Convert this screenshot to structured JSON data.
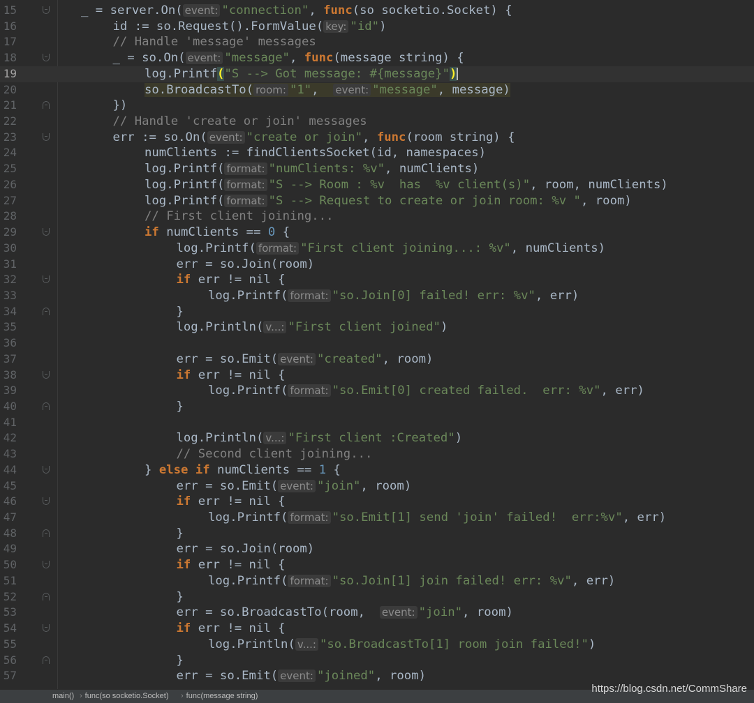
{
  "editor": {
    "current_line": 19,
    "lines": [
      {
        "n": 15,
        "fold": "open",
        "indent": 1,
        "tokens": [
          [
            "t",
            "_ = server.On("
          ],
          [
            "h",
            "event:"
          ],
          [
            "s",
            "\"connection\""
          ],
          [
            "t",
            ", "
          ],
          [
            "k",
            "func"
          ],
          [
            "t",
            "(so socketio.Socket) {"
          ]
        ]
      },
      {
        "n": 16,
        "indent": 2,
        "tokens": [
          [
            "t",
            "id := so.Request().FormValue("
          ],
          [
            "h",
            "key:"
          ],
          [
            "s",
            "\"id\""
          ],
          [
            "t",
            ")"
          ]
        ]
      },
      {
        "n": 17,
        "indent": 2,
        "tokens": [
          [
            "c",
            "// Handle 'message' messages"
          ]
        ]
      },
      {
        "n": 18,
        "fold": "open",
        "indent": 2,
        "tokens": [
          [
            "t",
            "_ = so.On("
          ],
          [
            "h",
            "event:"
          ],
          [
            "s",
            "\"message\""
          ],
          [
            "t",
            ", "
          ],
          [
            "k",
            "func"
          ],
          [
            "t",
            "(message string) {"
          ]
        ]
      },
      {
        "n": 19,
        "indent": 3,
        "tokens": [
          [
            "t",
            "log.Printf"
          ],
          [
            "b",
            "("
          ],
          [
            "s",
            "\"S --> Got message: #{message}\""
          ],
          [
            "b",
            ")"
          ],
          [
            "caret",
            ""
          ]
        ]
      },
      {
        "n": 20,
        "indent": 3,
        "highlight": true,
        "tokens": [
          [
            "t",
            "so.BroadcastTo("
          ],
          [
            "h",
            "room:"
          ],
          [
            "s",
            "\"1\""
          ],
          [
            "t",
            ",  "
          ],
          [
            "h",
            "event:"
          ],
          [
            "s",
            "\"message\""
          ],
          [
            "t",
            ", message)"
          ]
        ]
      },
      {
        "n": 21,
        "fold": "close",
        "indent": 2,
        "tokens": [
          [
            "t",
            "})"
          ]
        ]
      },
      {
        "n": 22,
        "indent": 2,
        "tokens": [
          [
            "c",
            "// Handle 'create or join' messages"
          ]
        ]
      },
      {
        "n": 23,
        "fold": "open",
        "indent": 2,
        "tokens": [
          [
            "t",
            "err := so.On("
          ],
          [
            "h",
            "event:"
          ],
          [
            "s",
            "\"create or join\""
          ],
          [
            "t",
            ", "
          ],
          [
            "k",
            "func"
          ],
          [
            "t",
            "(room string) {"
          ]
        ]
      },
      {
        "n": 24,
        "indent": 3,
        "tokens": [
          [
            "t",
            "numClients := findClientsSocket(id, namespaces)"
          ]
        ]
      },
      {
        "n": 25,
        "indent": 3,
        "tokens": [
          [
            "t",
            "log.Printf("
          ],
          [
            "h",
            "format:"
          ],
          [
            "s",
            "\"numClients: %v\""
          ],
          [
            "t",
            ", numClients)"
          ]
        ]
      },
      {
        "n": 26,
        "indent": 3,
        "tokens": [
          [
            "t",
            "log.Printf("
          ],
          [
            "h",
            "format:"
          ],
          [
            "s",
            "\"S --> Room : %v  has  %v client(s)\""
          ],
          [
            "t",
            ", room, numClients)"
          ]
        ]
      },
      {
        "n": 27,
        "indent": 3,
        "tokens": [
          [
            "t",
            "log.Printf("
          ],
          [
            "h",
            "format:"
          ],
          [
            "s",
            "\"S --> Request to create or join room: %v \""
          ],
          [
            "t",
            ", room)"
          ]
        ]
      },
      {
        "n": 28,
        "indent": 3,
        "tokens": [
          [
            "c",
            "// First client joining..."
          ]
        ]
      },
      {
        "n": 29,
        "fold": "open",
        "indent": 3,
        "tokens": [
          [
            "k",
            "if"
          ],
          [
            "t",
            " numClients == "
          ],
          [
            "n",
            "0"
          ],
          [
            "t",
            " {"
          ]
        ]
      },
      {
        "n": 30,
        "indent": 4,
        "tokens": [
          [
            "t",
            "log.Printf("
          ],
          [
            "h",
            "format:"
          ],
          [
            "s",
            "\"First client joining...: %v\""
          ],
          [
            "t",
            ", numClients)"
          ]
        ]
      },
      {
        "n": 31,
        "indent": 4,
        "tokens": [
          [
            "t",
            "err = so.Join(room)"
          ]
        ]
      },
      {
        "n": 32,
        "fold": "open",
        "indent": 4,
        "tokens": [
          [
            "k",
            "if"
          ],
          [
            "t",
            " err != nil {"
          ]
        ]
      },
      {
        "n": 33,
        "indent": 5,
        "tokens": [
          [
            "t",
            "log.Printf("
          ],
          [
            "h",
            "format:"
          ],
          [
            "s",
            "\"so.Join[0] failed! err: %v\""
          ],
          [
            "t",
            ", err)"
          ]
        ]
      },
      {
        "n": 34,
        "fold": "close",
        "indent": 4,
        "tokens": [
          [
            "t",
            "}"
          ]
        ]
      },
      {
        "n": 35,
        "indent": 4,
        "tokens": [
          [
            "t",
            "log.Println("
          ],
          [
            "h",
            "v...:"
          ],
          [
            "s",
            "\"First client joined\""
          ],
          [
            "t",
            ")"
          ]
        ]
      },
      {
        "n": 36,
        "indent": 0,
        "tokens": []
      },
      {
        "n": 37,
        "indent": 4,
        "tokens": [
          [
            "t",
            "err = so.Emit("
          ],
          [
            "h",
            "event:"
          ],
          [
            "s",
            "\"created\""
          ],
          [
            "t",
            ", room)"
          ]
        ]
      },
      {
        "n": 38,
        "fold": "open",
        "indent": 4,
        "tokens": [
          [
            "k",
            "if"
          ],
          [
            "t",
            " err != nil {"
          ]
        ]
      },
      {
        "n": 39,
        "indent": 5,
        "tokens": [
          [
            "t",
            "log.Printf("
          ],
          [
            "h",
            "format:"
          ],
          [
            "s",
            "\"so.Emit[0] created failed.  err: %v\""
          ],
          [
            "t",
            ", err)"
          ]
        ]
      },
      {
        "n": 40,
        "fold": "close",
        "indent": 4,
        "tokens": [
          [
            "t",
            "}"
          ]
        ]
      },
      {
        "n": 41,
        "indent": 0,
        "tokens": []
      },
      {
        "n": 42,
        "indent": 4,
        "tokens": [
          [
            "t",
            "log.Println("
          ],
          [
            "h",
            "v...:"
          ],
          [
            "s",
            "\"First client :Created\""
          ],
          [
            "t",
            ")"
          ]
        ]
      },
      {
        "n": 43,
        "indent": 4,
        "tokens": [
          [
            "c",
            "// Second client joining..."
          ]
        ]
      },
      {
        "n": 44,
        "fold": "open",
        "indent": 3,
        "tokens": [
          [
            "t",
            "} "
          ],
          [
            "k",
            "else if"
          ],
          [
            "t",
            " numClients == "
          ],
          [
            "n",
            "1"
          ],
          [
            "t",
            " {"
          ]
        ]
      },
      {
        "n": 45,
        "indent": 4,
        "tokens": [
          [
            "t",
            "err = so.Emit("
          ],
          [
            "h",
            "event:"
          ],
          [
            "s",
            "\"join\""
          ],
          [
            "t",
            ", room)"
          ]
        ]
      },
      {
        "n": 46,
        "fold": "open",
        "indent": 4,
        "tokens": [
          [
            "k",
            "if"
          ],
          [
            "t",
            " err != nil {"
          ]
        ]
      },
      {
        "n": 47,
        "indent": 5,
        "tokens": [
          [
            "t",
            "log.Printf("
          ],
          [
            "h",
            "format:"
          ],
          [
            "s",
            "\"so.Emit[1] send 'join' failed!  err:%v\""
          ],
          [
            "t",
            ", err)"
          ]
        ]
      },
      {
        "n": 48,
        "fold": "close",
        "indent": 4,
        "tokens": [
          [
            "t",
            "}"
          ]
        ]
      },
      {
        "n": 49,
        "indent": 4,
        "tokens": [
          [
            "t",
            "err = so.Join(room)"
          ]
        ]
      },
      {
        "n": 50,
        "fold": "open",
        "indent": 4,
        "tokens": [
          [
            "k",
            "if"
          ],
          [
            "t",
            " err != nil {"
          ]
        ]
      },
      {
        "n": 51,
        "indent": 5,
        "tokens": [
          [
            "t",
            "log.Printf("
          ],
          [
            "h",
            "format:"
          ],
          [
            "s",
            "\"so.Join[1] join failed! err: %v\""
          ],
          [
            "t",
            ", err)"
          ]
        ]
      },
      {
        "n": 52,
        "fold": "close",
        "indent": 4,
        "tokens": [
          [
            "t",
            "}"
          ]
        ]
      },
      {
        "n": 53,
        "indent": 4,
        "tokens": [
          [
            "t",
            "err = so.BroadcastTo(room,  "
          ],
          [
            "h",
            "event:"
          ],
          [
            "s",
            "\"join\""
          ],
          [
            "t",
            ", room)"
          ]
        ]
      },
      {
        "n": 54,
        "fold": "open",
        "indent": 4,
        "tokens": [
          [
            "k",
            "if"
          ],
          [
            "t",
            " err != nil {"
          ]
        ]
      },
      {
        "n": 55,
        "indent": 5,
        "tokens": [
          [
            "t",
            "log.Println("
          ],
          [
            "h",
            "v...:"
          ],
          [
            "s",
            "\"so.BroadcastTo[1] room join failed!\""
          ],
          [
            "t",
            ")"
          ]
        ]
      },
      {
        "n": 56,
        "fold": "close",
        "indent": 4,
        "tokens": [
          [
            "t",
            "}"
          ]
        ]
      },
      {
        "n": 57,
        "indent": 4,
        "tokens": [
          [
            "t",
            "err = so.Emit("
          ],
          [
            "h",
            "event:"
          ],
          [
            "s",
            "\"joined\""
          ],
          [
            "t",
            ", room)"
          ]
        ]
      }
    ]
  },
  "statusbar": {
    "breadcrumbs": [
      "main()",
      "func(so socketio.Socket)",
      "func(message string)"
    ]
  },
  "watermark": "https://blog.csdn.net/CommShare",
  "colors": {
    "background": "#2b2b2b",
    "keyword": "#cc7832",
    "string": "#6a8759",
    "number": "#6897bb",
    "comment": "#808080",
    "text": "#a9b7c6"
  }
}
